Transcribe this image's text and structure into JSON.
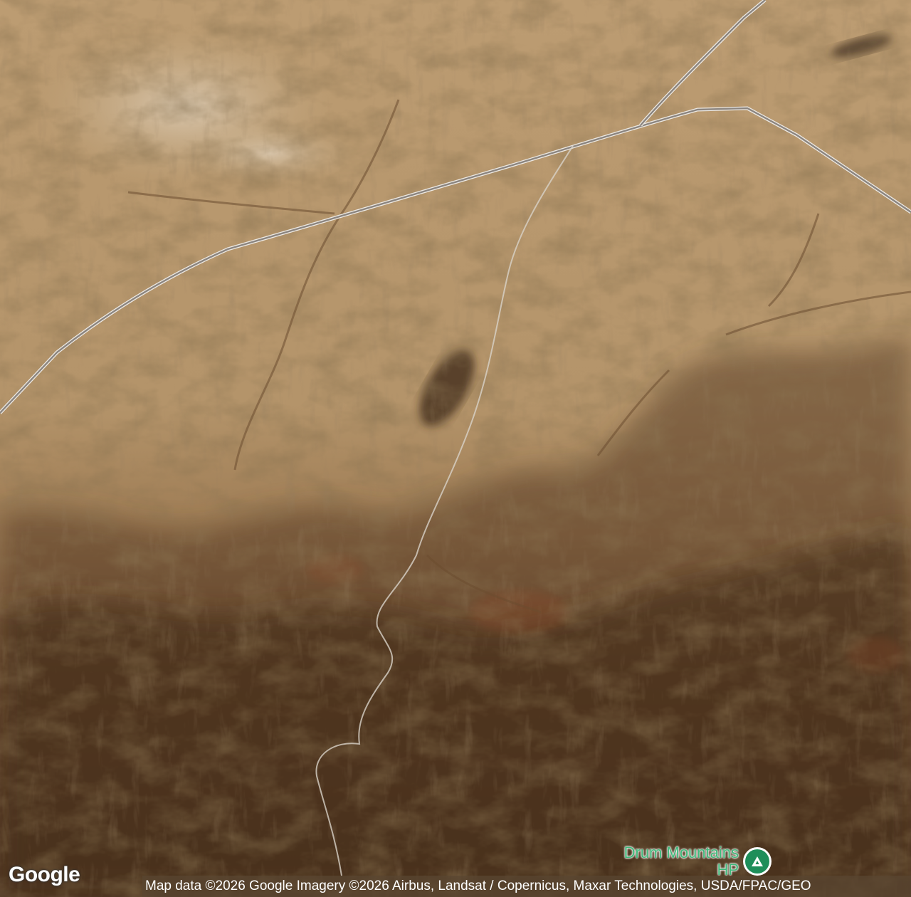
{
  "map": {
    "type": "satellite",
    "colors": {
      "terrain_light": "#c4a57c",
      "terrain_mid": "#a27f58",
      "terrain_dark": "#4a3320",
      "road": "#8b8580",
      "road_edge": "#ece8e2",
      "poi_green": "#1e8e5a"
    }
  },
  "poi": {
    "label": "Drum Mountains HP",
    "icon": "mountain-icon"
  },
  "branding": {
    "logo_text": "Google"
  },
  "attribution": {
    "text": "Map data ©2026 Google Imagery ©2026 Airbus, Landsat / Copernicus, Maxar Technologies, USDA/FPAC/GEO"
  }
}
